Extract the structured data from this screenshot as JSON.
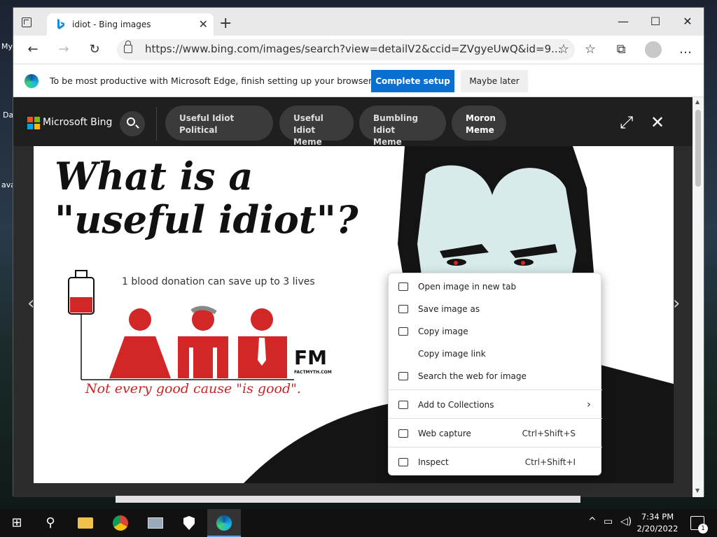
{
  "desktop": {
    "fragments": [
      "My",
      "Da",
      "ava"
    ]
  },
  "browser": {
    "tab": {
      "title": "idiot - Bing images",
      "close_glyph": "✕"
    },
    "new_tab_glyph": "+",
    "window_controls": {
      "minimize": "—",
      "maximize": "☐",
      "close": "✕"
    },
    "toolbar": {
      "back_glyph": "←",
      "forward_glyph": "→",
      "refresh_glyph": "↻",
      "url": "https://www.bing.com/images/search?view=detailV2&ccid=ZVgyeUwQ&id=9...",
      "add_favorite_glyph": "☆",
      "favorites_glyph": "☆",
      "collections_glyph": "⧉",
      "more_glyph": "…"
    },
    "infobar": {
      "message": "To be most productive with Microsoft Edge, finish setting up your browser.",
      "primary_button": "Complete setup",
      "secondary_button": "Maybe later"
    }
  },
  "bing": {
    "brand": "Microsoft Bing",
    "logo_colors": [
      "#f25022",
      "#7fba00",
      "#00a4ef",
      "#ffb900"
    ],
    "chips": [
      {
        "line1": "Useful Idiot Political",
        "line2": ""
      },
      {
        "line1": "Useful Idiot",
        "line2": "Meme"
      },
      {
        "line1": "Bumbling Idiot",
        "line2": "Meme"
      },
      {
        "line1": "Moron",
        "line2": "Meme"
      }
    ],
    "expand_glyph": "⤢",
    "close_glyph": "✕",
    "prev_glyph": "‹",
    "next_glyph": "›"
  },
  "image": {
    "headline_line1": "What is a",
    "headline_line2": "\"useful idiot\"?",
    "donation_text": "1 blood donation can save up to 3 lives",
    "brand_mark": "FM",
    "brand_site": "FACTMYTH.COM",
    "tagline": "Not every good cause \"is good\".",
    "accent_color": "#d32626"
  },
  "context_menu": {
    "items": [
      {
        "label": "Open image in new tab",
        "shortcut": ""
      },
      {
        "label": "Save image as",
        "shortcut": ""
      },
      {
        "label": "Copy image",
        "shortcut": ""
      },
      {
        "label": "Copy image link",
        "shortcut": ""
      },
      {
        "label": "Search the web for image",
        "shortcut": ""
      },
      {
        "label": "Add to Collections",
        "shortcut": ""
      },
      {
        "label": "Web capture",
        "shortcut": "Ctrl+Shift+S"
      },
      {
        "label": "Inspect",
        "shortcut": "Ctrl+Shift+I"
      }
    ],
    "submenu_glyph": "›"
  },
  "taskbar": {
    "start_glyph": "⊞",
    "search_glyph": "⚲",
    "tray_chevron": "^",
    "time": "7:34 PM",
    "date": "2/20/2022",
    "notification_count": "1"
  }
}
